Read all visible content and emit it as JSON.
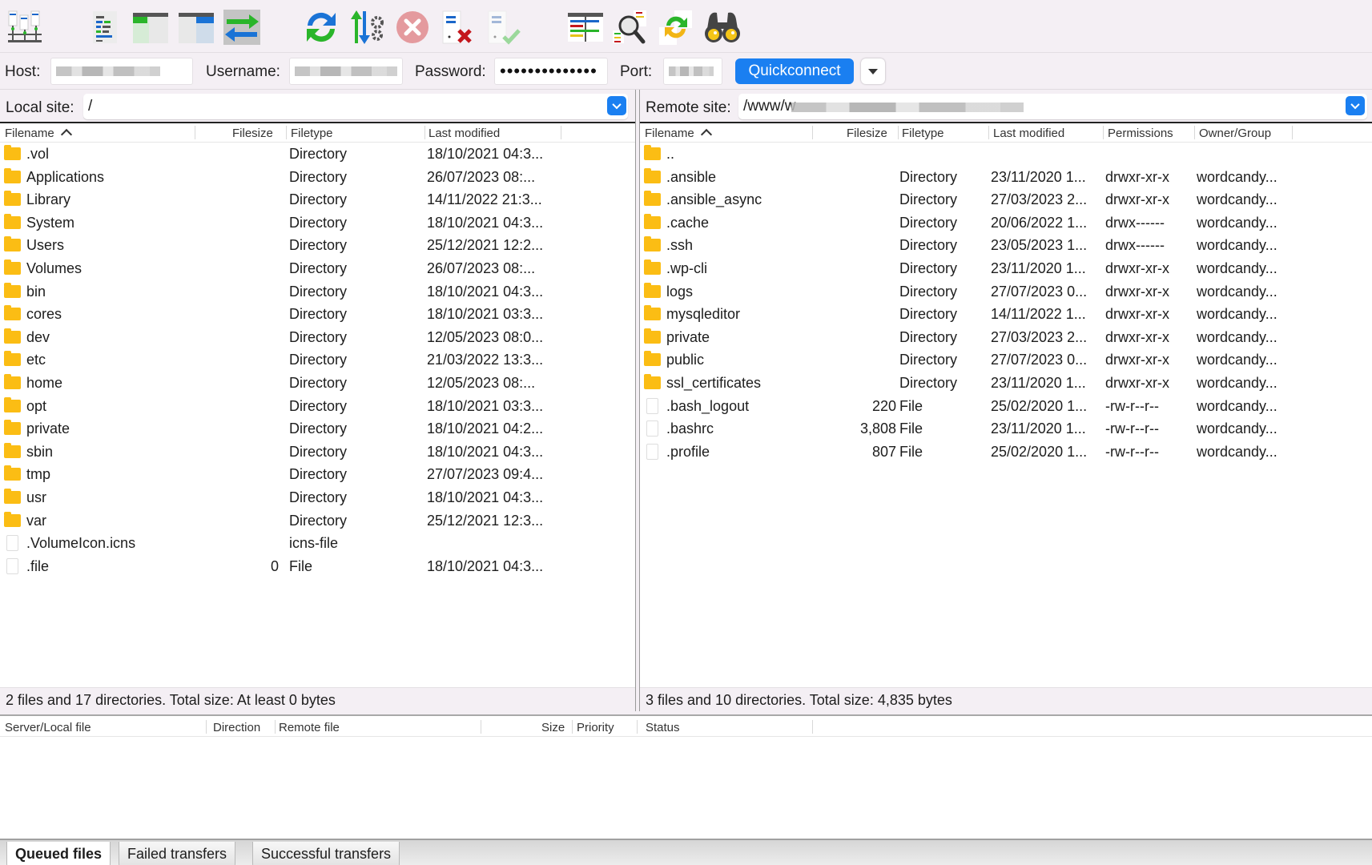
{
  "toolbar": {
    "icons": [
      "site-manager-icon",
      "toggle-message-log-icon",
      "toggle-local-tree-icon",
      "toggle-remote-tree-icon",
      "toggle-transfer-queue-icon",
      "refresh-icon",
      "process-queue-icon",
      "cancel-operation-icon",
      "disconnect-icon",
      "reconnect-icon",
      "directory-listing-filters-icon",
      "toggle-filename-filters-icon",
      "synchronized-browsing-icon",
      "search-remote-files-icon"
    ]
  },
  "quickconnect": {
    "host_label": "Host:",
    "host_value": "",
    "username_label": "Username:",
    "username_value": "",
    "password_label": "Password:",
    "password_value": "••••••••••••••",
    "port_label": "Port:",
    "port_value": "",
    "button_label": "Quickconnect",
    "accent_color": "#1a7ff1"
  },
  "local": {
    "site_label": "Local site:",
    "site_path": "/",
    "columns": [
      "Filename",
      "Filesize",
      "Filetype",
      "Last modified"
    ],
    "rows": [
      {
        "name": ".vol",
        "size": "",
        "type": "Directory",
        "modified": "18/10/2021 04:3...",
        "kind": "folder"
      },
      {
        "name": "Applications",
        "size": "",
        "type": "Directory",
        "modified": "26/07/2023 08:...",
        "kind": "folder"
      },
      {
        "name": "Library",
        "size": "",
        "type": "Directory",
        "modified": "14/11/2022 21:3...",
        "kind": "folder"
      },
      {
        "name": "System",
        "size": "",
        "type": "Directory",
        "modified": "18/10/2021 04:3...",
        "kind": "folder"
      },
      {
        "name": "Users",
        "size": "",
        "type": "Directory",
        "modified": "25/12/2021 12:2...",
        "kind": "folder"
      },
      {
        "name": "Volumes",
        "size": "",
        "type": "Directory",
        "modified": "26/07/2023 08:...",
        "kind": "folder"
      },
      {
        "name": "bin",
        "size": "",
        "type": "Directory",
        "modified": "18/10/2021 04:3...",
        "kind": "folder"
      },
      {
        "name": "cores",
        "size": "",
        "type": "Directory",
        "modified": "18/10/2021 03:3...",
        "kind": "folder"
      },
      {
        "name": "dev",
        "size": "",
        "type": "Directory",
        "modified": "12/05/2023 08:0...",
        "kind": "folder"
      },
      {
        "name": "etc",
        "size": "",
        "type": "Directory",
        "modified": "21/03/2022 13:3...",
        "kind": "folder"
      },
      {
        "name": "home",
        "size": "",
        "type": "Directory",
        "modified": "12/05/2023 08:...",
        "kind": "folder"
      },
      {
        "name": "opt",
        "size": "",
        "type": "Directory",
        "modified": "18/10/2021 03:3...",
        "kind": "folder"
      },
      {
        "name": "private",
        "size": "",
        "type": "Directory",
        "modified": "18/10/2021 04:2...",
        "kind": "folder"
      },
      {
        "name": "sbin",
        "size": "",
        "type": "Directory",
        "modified": "18/10/2021 04:3...",
        "kind": "folder"
      },
      {
        "name": "tmp",
        "size": "",
        "type": "Directory",
        "modified": "27/07/2023 09:4...",
        "kind": "folder"
      },
      {
        "name": "usr",
        "size": "",
        "type": "Directory",
        "modified": "18/10/2021 04:3...",
        "kind": "folder"
      },
      {
        "name": "var",
        "size": "",
        "type": "Directory",
        "modified": "25/12/2021 12:3...",
        "kind": "folder"
      },
      {
        "name": ".VolumeIcon.icns",
        "size": "",
        "type": "icns-file",
        "modified": "",
        "kind": "file"
      },
      {
        "name": ".file",
        "size": "0",
        "type": "File",
        "modified": "18/10/2021 04:3...",
        "kind": "file"
      }
    ],
    "status": "2 files and 17 directories. Total size: At least 0 bytes"
  },
  "remote": {
    "site_label": "Remote site:",
    "site_path": "/www/w",
    "columns": [
      "Filename",
      "Filesize",
      "Filetype",
      "Last modified",
      "Permissions",
      "Owner/Group"
    ],
    "rows": [
      {
        "name": "..",
        "size": "",
        "type": "",
        "modified": "",
        "perms": "",
        "owner": "",
        "kind": "folder"
      },
      {
        "name": ".ansible",
        "size": "",
        "type": "Directory",
        "modified": "23/11/2020 1...",
        "perms": "drwxr-xr-x",
        "owner": "wordcandy...",
        "kind": "folder"
      },
      {
        "name": ".ansible_async",
        "size": "",
        "type": "Directory",
        "modified": "27/03/2023 2...",
        "perms": "drwxr-xr-x",
        "owner": "wordcandy...",
        "kind": "folder"
      },
      {
        "name": ".cache",
        "size": "",
        "type": "Directory",
        "modified": "20/06/2022 1...",
        "perms": "drwx------",
        "owner": "wordcandy...",
        "kind": "folder"
      },
      {
        "name": ".ssh",
        "size": "",
        "type": "Directory",
        "modified": "23/05/2023 1...",
        "perms": "drwx------",
        "owner": "wordcandy...",
        "kind": "folder"
      },
      {
        "name": ".wp-cli",
        "size": "",
        "type": "Directory",
        "modified": "23/11/2020 1...",
        "perms": "drwxr-xr-x",
        "owner": "wordcandy...",
        "kind": "folder"
      },
      {
        "name": "logs",
        "size": "",
        "type": "Directory",
        "modified": "27/07/2023 0...",
        "perms": "drwxr-xr-x",
        "owner": "wordcandy...",
        "kind": "folder"
      },
      {
        "name": "mysqleditor",
        "size": "",
        "type": "Directory",
        "modified": "14/11/2022 1...",
        "perms": "drwxr-xr-x",
        "owner": "wordcandy...",
        "kind": "folder"
      },
      {
        "name": "private",
        "size": "",
        "type": "Directory",
        "modified": "27/03/2023 2...",
        "perms": "drwxr-xr-x",
        "owner": "wordcandy...",
        "kind": "folder"
      },
      {
        "name": "public",
        "size": "",
        "type": "Directory",
        "modified": "27/07/2023 0...",
        "perms": "drwxr-xr-x",
        "owner": "wordcandy...",
        "kind": "folder"
      },
      {
        "name": "ssl_certificates",
        "size": "",
        "type": "Directory",
        "modified": "23/11/2020 1...",
        "perms": "drwxr-xr-x",
        "owner": "wordcandy...",
        "kind": "folder"
      },
      {
        "name": ".bash_logout",
        "size": "220",
        "type": "File",
        "modified": "25/02/2020 1...",
        "perms": "-rw-r--r--",
        "owner": "wordcandy...",
        "kind": "file"
      },
      {
        "name": ".bashrc",
        "size": "3,808",
        "type": "File",
        "modified": "23/11/2020 1...",
        "perms": "-rw-r--r--",
        "owner": "wordcandy...",
        "kind": "file"
      },
      {
        "name": ".profile",
        "size": "807",
        "type": "File",
        "modified": "25/02/2020 1...",
        "perms": "-rw-r--r--",
        "owner": "wordcandy...",
        "kind": "file"
      }
    ],
    "status": "3 files and 10 directories. Total size: 4,835 bytes"
  },
  "queue": {
    "columns": [
      "Server/Local file",
      "Direction",
      "Remote file",
      "Size",
      "Priority",
      "Status"
    ],
    "tabs": [
      {
        "label": "Queued files",
        "active": true
      },
      {
        "label": "Failed transfers",
        "active": false
      },
      {
        "label": "Successful transfers",
        "active": false
      }
    ]
  }
}
